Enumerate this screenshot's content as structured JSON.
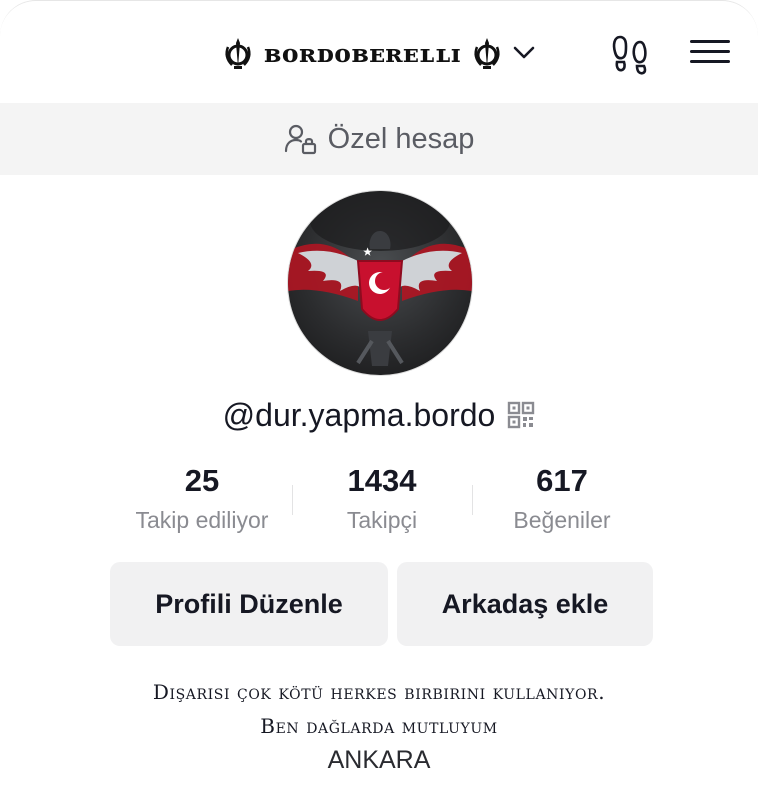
{
  "header": {
    "title": "ʙᴏʀᴅᴏʙᴇʀᴇʟʟɪ",
    "title_icon": "khanda-icon",
    "dropdown_icon": "chevron-down-icon",
    "footprints_icon": "footprints-icon",
    "menu_icon": "hamburger-menu-icon"
  },
  "private_banner": {
    "icon": "private-account-icon",
    "text": "Özel hesap"
  },
  "profile": {
    "username": "@dur.yapma.bordo",
    "qr_icon": "qr-code-icon"
  },
  "stats": [
    {
      "value": "25",
      "label": "Takip ediliyor"
    },
    {
      "value": "1434",
      "label": "Takipçi"
    },
    {
      "value": "617",
      "label": "Beğeniler"
    }
  ],
  "buttons": {
    "edit_profile": "Profili Düzenle",
    "add_friend": "Arkadaş ekle"
  },
  "bio": {
    "line1": "Dışarısı çok kötü herkes birbirini kullanıyor.",
    "line2": "Ben dağlarda mutluyum",
    "line3": "ANKARA"
  },
  "colors": {
    "text": "#161823",
    "muted": "#8a8b91",
    "banner_bg": "#f4f4f4",
    "button_bg": "#f1f1f2",
    "avatar_red": "#c8102e"
  }
}
